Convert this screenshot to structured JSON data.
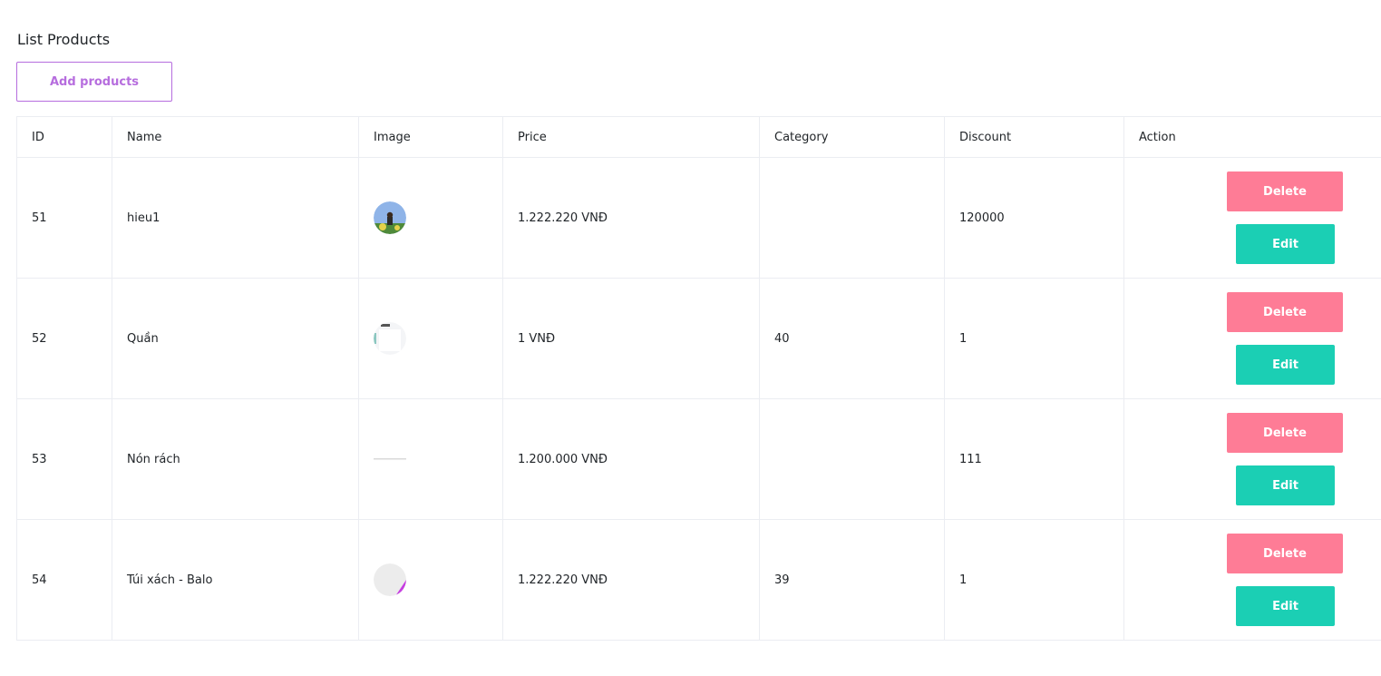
{
  "page": {
    "title": "List Products",
    "add_button_label": "Add products"
  },
  "table": {
    "headers": {
      "id": "ID",
      "name": "Name",
      "image": "Image",
      "price": "Price",
      "category": "Category",
      "discount": "Discount",
      "action": "Action"
    },
    "rows": [
      {
        "id": "51",
        "name": "hieu1",
        "image": "product-image-hieu1",
        "price": "1.222.220 VNĐ",
        "category": "",
        "discount": "120000",
        "delete_label": "Delete",
        "edit_label": "Edit"
      },
      {
        "id": "52",
        "name": "Quần",
        "image": "product-image-quan",
        "price": "1 VNĐ",
        "category": "40",
        "discount": "1",
        "delete_label": "Delete",
        "edit_label": "Edit"
      },
      {
        "id": "53",
        "name": "Nón rách",
        "image": "product-image-non-rach",
        "price": "1.200.000 VNĐ",
        "category": "",
        "discount": "111",
        "delete_label": "Delete",
        "edit_label": "Edit"
      },
      {
        "id": "54",
        "name": "Túi xách - Balo",
        "image": "product-image-tui-xach",
        "price": "1.222.220 VNĐ",
        "category": "39",
        "discount": "1",
        "delete_label": "Delete",
        "edit_label": "Edit"
      }
    ]
  },
  "colors": {
    "accent": "#b66dde",
    "delete": "#fe7c96",
    "edit": "#1bcfb4",
    "border": "#ebedf2"
  }
}
